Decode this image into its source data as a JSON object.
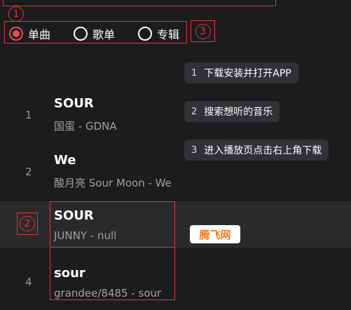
{
  "annotations": {
    "marker_1": "1",
    "marker_2": "2",
    "marker_3": "3"
  },
  "search_type": {
    "options": [
      {
        "label": "单曲",
        "selected": true
      },
      {
        "label": "歌单",
        "selected": false
      },
      {
        "label": "专辑",
        "selected": false
      }
    ]
  },
  "steps": [
    {
      "num": "1",
      "text": "下载安装并打开APP"
    },
    {
      "num": "2",
      "text": "搜索想听的音乐"
    },
    {
      "num": "3",
      "text": "进入播放页点击右上角下载"
    }
  ],
  "songs": [
    {
      "index": "1",
      "title": "SOUR",
      "subtitle": "国蛋 - GDNA"
    },
    {
      "index": "2",
      "title": "We",
      "subtitle": "酸月亮 Sour Moon - We"
    },
    {
      "index": "",
      "title": "SOUR",
      "subtitle": "JUNNY - null"
    },
    {
      "index": "4",
      "title": "sour",
      "subtitle": "grandee/8485 - sour"
    }
  ],
  "watermark": "腾飞网",
  "colors": {
    "accent": "#e94a55",
    "annotation": "#e0353f",
    "background": "#1c1c1e"
  }
}
